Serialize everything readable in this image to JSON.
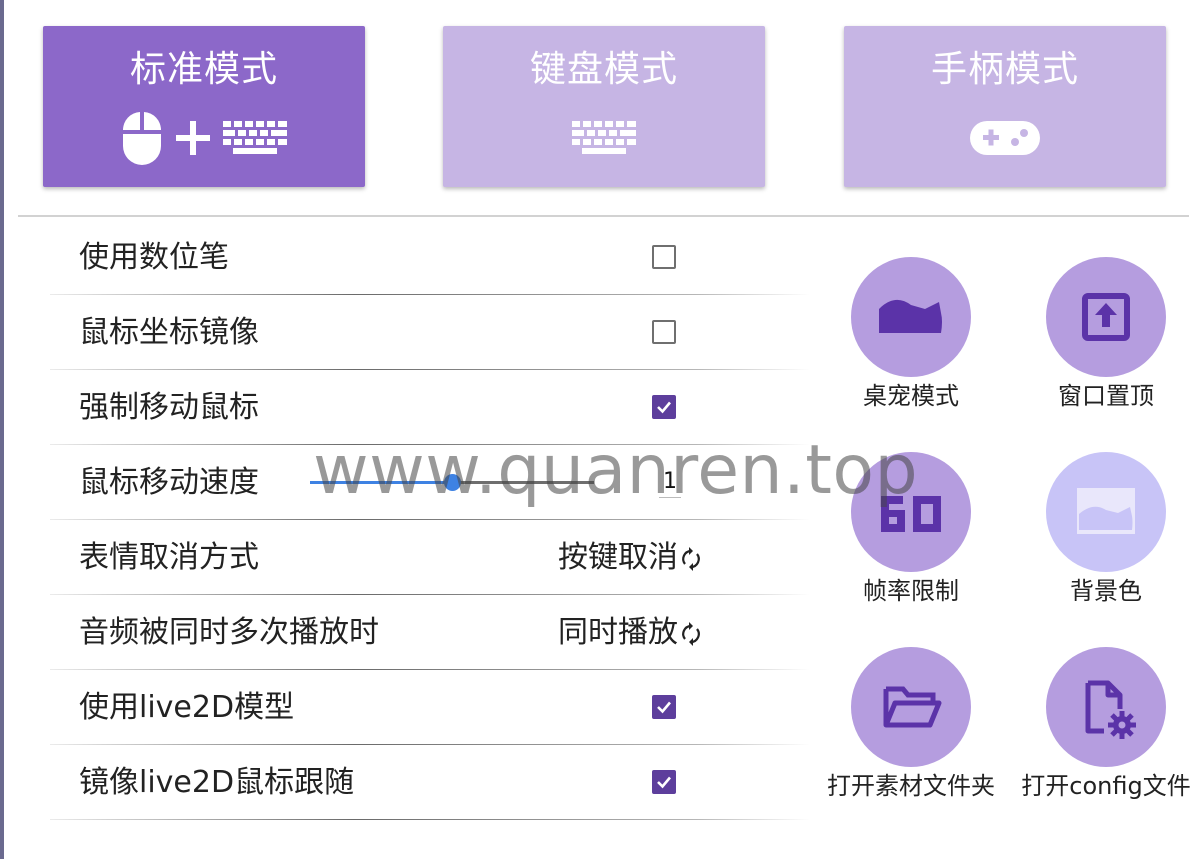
{
  "modes": [
    {
      "label": "标准模式",
      "active": true,
      "icons": [
        "mouse-icon",
        "plus-icon",
        "keyboard-icon"
      ]
    },
    {
      "label": "键盘模式",
      "active": false,
      "icons": [
        "keyboard-icon"
      ]
    },
    {
      "label": "手柄模式",
      "active": false,
      "icons": [
        "gamepad-icon"
      ]
    }
  ],
  "settings": {
    "digital_pen": {
      "label": "使用数位笔",
      "checked": false
    },
    "mouse_mirror": {
      "label": "鼠标坐标镜像",
      "checked": false
    },
    "force_move": {
      "label": "强制移动鼠标",
      "checked": true
    },
    "mouse_speed": {
      "label": "鼠标移动速度",
      "value": "1",
      "slider_fraction": 0.5
    },
    "emote_cancel": {
      "label": "表情取消方式",
      "value": "按键取消"
    },
    "audio_overlap": {
      "label": "音频被同时多次播放时",
      "value": "同时播放"
    },
    "use_live2d": {
      "label": "使用live2D模型",
      "checked": true
    },
    "mirror_live2d": {
      "label": "镜像live2D鼠标跟随",
      "checked": true
    }
  },
  "buttons": {
    "pet_mode": {
      "label": "桌宠模式",
      "icon": "cat-icon"
    },
    "window_top": {
      "label": "窗口置顶",
      "icon": "pin-top-icon"
    },
    "fps_limit": {
      "label": "帧率限制",
      "icon": "fps-60-icon",
      "icon_text": "60"
    },
    "background_color": {
      "label": "背景色",
      "icon": "cat-image-icon"
    },
    "open_assets": {
      "label": "打开素材文件夹",
      "icon": "folder-open-icon"
    },
    "open_config": {
      "label": "打开config文件",
      "icon": "file-settings-icon"
    }
  },
  "watermark": "www.quanren.top",
  "colors": {
    "active_mode": "#8c68c9",
    "inactive_mode": "#c6b5e4",
    "checkbox_checked": "#5d3e9c",
    "circle": "#b59ddf",
    "circle_light": "#c8c4f7",
    "icon_dark": "#5b33a8",
    "slider": "#3e82e3"
  }
}
